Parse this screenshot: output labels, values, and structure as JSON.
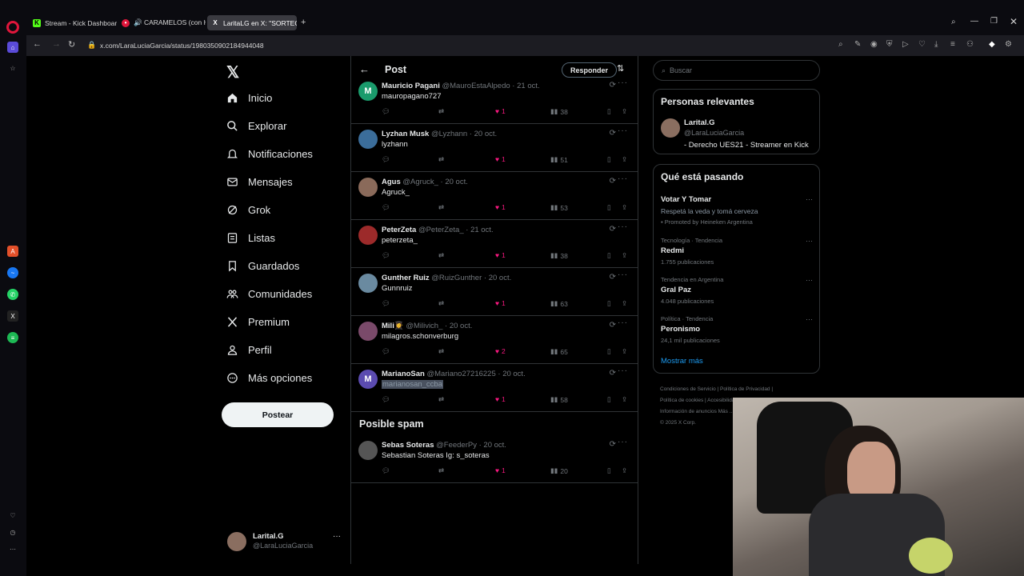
{
  "browser": {
    "tabs": [
      {
        "label": "Stream - Kick Dashboard",
        "active": false
      },
      {
        "label": "🔊 CARAMELOS (con Hal",
        "active": false
      },
      {
        "label": "LaritaLG en X: \"SORTEO -",
        "active": true
      }
    ],
    "url": "x.com/LaraLuciaGarcia/status/1980350902184944048"
  },
  "nav": {
    "items": [
      "Inicio",
      "Explorar",
      "Notificaciones",
      "Mensajes",
      "Grok",
      "Listas",
      "Guardados",
      "Comunidades",
      "Premium",
      "Perfil",
      "Más opciones"
    ],
    "post_button": "Postear",
    "account": {
      "name": "Larital.G",
      "handle": "@LaraLuciaGarcia"
    }
  },
  "post_header": {
    "title": "Post",
    "reply_button": "Responder"
  },
  "replies": [
    {
      "name": "Mauricio Pagani",
      "handle": "@MauroEstaAlpedo",
      "date": "21 oct.",
      "text": "mauropagano727",
      "likes": "1",
      "views": "38",
      "avatar_letter": "M",
      "avatar_color": "#1a9b6c"
    },
    {
      "name": "Lyzhan Musk",
      "handle": "@Lyzhann",
      "date": "20 oct.",
      "text": "lyzhann",
      "likes": "1",
      "views": "51",
      "avatar_letter": "",
      "avatar_color": "#3b6d9a"
    },
    {
      "name": "Agus",
      "handle": "@Agruck_",
      "date": "20 oct.",
      "text": "Agruck_",
      "likes": "1",
      "views": "53",
      "avatar_letter": "",
      "avatar_color": "#8a6a5a"
    },
    {
      "name": "PeterZeta",
      "handle": "@PeterZeta_",
      "date": "21 oct.",
      "text": "peterzeta_",
      "likes": "1",
      "views": "38",
      "avatar_letter": "",
      "avatar_color": "#9c2a2a"
    },
    {
      "name": "Gunther Ruiz",
      "handle": "@RuizGunther",
      "date": "20 oct.",
      "text": "Gunnruiz",
      "likes": "1",
      "views": "63",
      "avatar_letter": "",
      "avatar_color": "#6a8aa0"
    },
    {
      "name": "Mili👩‍🎓",
      "handle": "@Milivich_",
      "date": "20 oct.",
      "text": "milagros.schonverburg",
      "likes": "2",
      "views": "65",
      "avatar_letter": "",
      "avatar_color": "#7a4a6a"
    },
    {
      "name": "MarianoSan",
      "handle": "@Mariano27216225",
      "date": "20 oct.",
      "text": "marianosan_ccba",
      "likes": "1",
      "views": "58",
      "avatar_letter": "M",
      "avatar_color": "#5b4bb0"
    }
  ],
  "spam": {
    "title": "Posible spam",
    "reply": {
      "name": "Sebas Soteras",
      "handle": "@FeederPy",
      "date": "20 oct.",
      "text": "Sebastian Soteras Ig: s_soteras",
      "likes": "1",
      "views": "20",
      "avatar_letter": "",
      "avatar_color": "#555"
    }
  },
  "sidebar": {
    "search_placeholder": "Buscar",
    "relevant": {
      "title": "Personas relevantes",
      "name": "Larital.G",
      "handle": "@LaraLuciaGarcia",
      "bio": "- Derecho UES21 - Streamer en Kick"
    },
    "trending": {
      "title": "Qué está pasando",
      "items": [
        {
          "meta": "",
          "topic": "Votar Y Tomar",
          "count": "Respetá la veda y tomá cerveza",
          "promo": "Promoted by Heineken Argentina"
        },
        {
          "meta": "Tecnología · Tendencia",
          "topic": "Redmi",
          "count": "1.755 publicaciones",
          "promo": ""
        },
        {
          "meta": "Tendencia en Argentina",
          "topic": "Gral Paz",
          "count": "4.048 publicaciones",
          "promo": ""
        },
        {
          "meta": "Política · Tendencia",
          "topic": "Peronismo",
          "count": "24,1 mil publicaciones",
          "promo": ""
        }
      ],
      "show_more": "Mostrar más"
    },
    "footer": [
      "Condiciones de Servicio",
      "Política de Privacidad",
      "Política de cookies",
      "Accesibilidad",
      "Información de anuncios",
      "Más ...",
      "© 2025 X Corp."
    ]
  },
  "colors": {
    "accent": "#1d9bf0",
    "like": "#f91880",
    "border": "#2f3336",
    "muted": "#71767b"
  }
}
